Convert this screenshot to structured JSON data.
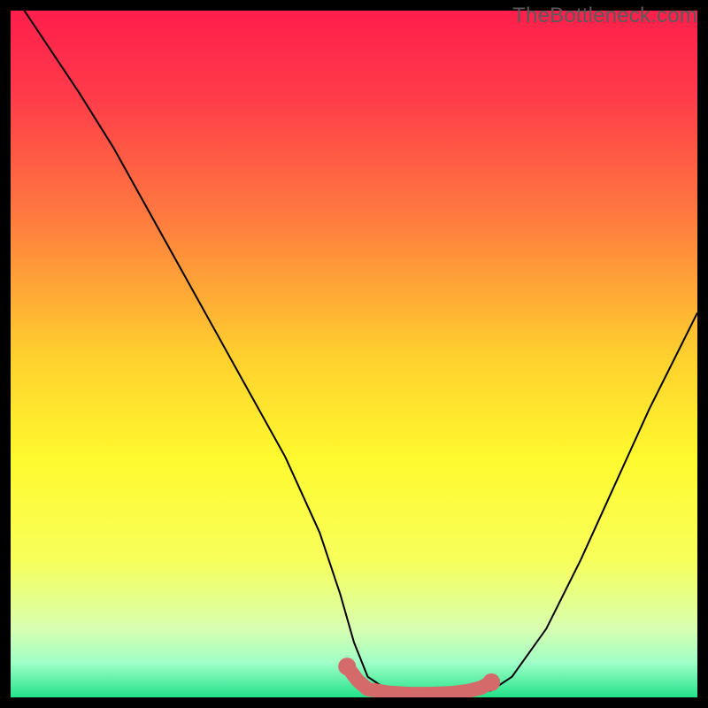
{
  "attribution": "TheBottleneck.com",
  "chart_data": {
    "type": "line",
    "title": "",
    "xlabel": "",
    "ylabel": "",
    "xlim": [
      0,
      100
    ],
    "ylim": [
      0,
      100
    ],
    "background_gradient": {
      "stops": [
        {
          "offset": 0.0,
          "color": "#ff1f4c"
        },
        {
          "offset": 0.12,
          "color": "#ff3a4a"
        },
        {
          "offset": 0.3,
          "color": "#ff7a3f"
        },
        {
          "offset": 0.5,
          "color": "#ffcf2e"
        },
        {
          "offset": 0.65,
          "color": "#fff92e"
        },
        {
          "offset": 0.8,
          "color": "#f7ff5a"
        },
        {
          "offset": 0.9,
          "color": "#d8ffb0"
        },
        {
          "offset": 0.95,
          "color": "#9fffc7"
        },
        {
          "offset": 1.0,
          "color": "#22e28a"
        }
      ]
    },
    "series": [
      {
        "name": "bottleneck-curve",
        "color": "#000000",
        "x": [
          2,
          6,
          10,
          15,
          20,
          25,
          30,
          35,
          40,
          45,
          48,
          50,
          52,
          55,
          60,
          65,
          68,
          70,
          73,
          78,
          83,
          88,
          93,
          98,
          100
        ],
        "y": [
          100,
          94,
          88,
          80,
          71,
          62,
          53,
          44,
          35,
          24,
          15,
          8,
          3,
          1,
          0.5,
          0.5,
          0.8,
          1,
          3,
          10,
          20,
          31,
          42,
          52,
          56
        ]
      }
    ],
    "markers": {
      "name": "optimal-range",
      "color": "#d46a6a",
      "points": [
        {
          "x": 49,
          "y": 4.5
        },
        {
          "x": 50.5,
          "y": 2.5
        },
        {
          "x": 52,
          "y": 1.2
        },
        {
          "x": 55,
          "y": 0.7
        },
        {
          "x": 58,
          "y": 0.5
        },
        {
          "x": 61,
          "y": 0.5
        },
        {
          "x": 64,
          "y": 0.6
        },
        {
          "x": 66.5,
          "y": 0.9
        },
        {
          "x": 68.5,
          "y": 1.4
        },
        {
          "x": 70,
          "y": 2.2
        }
      ]
    }
  }
}
